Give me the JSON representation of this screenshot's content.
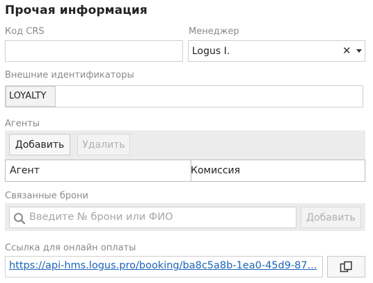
{
  "section_title": "Прочая информация",
  "crs": {
    "label": "Код CRS",
    "value": ""
  },
  "manager": {
    "label": "Менеджер",
    "value": "Logus I.",
    "clear_icon": "close-icon",
    "dropdown_icon": "chevron-down-icon"
  },
  "external_ids": {
    "label": "Внешние идентификаторы",
    "chips": [
      "LOYALTY"
    ],
    "value": ""
  },
  "agents": {
    "label": "Агенты",
    "add_label": "Добавить",
    "delete_label": "Удалить",
    "columns": [
      "Агент",
      "Комиссия"
    ]
  },
  "linked_bookings": {
    "label": "Связанные брони",
    "search_placeholder": "Введите № брони или ФИО",
    "search_icon": "search-icon",
    "add_label": "Добавить"
  },
  "payment_link": {
    "label": "Ссылка для онлайн оплаты",
    "url": "https://api-hms.logus.pro/booking/ba8c5a8b-1ea0-45d9-87...",
    "copy_icon": "copy-icon"
  }
}
